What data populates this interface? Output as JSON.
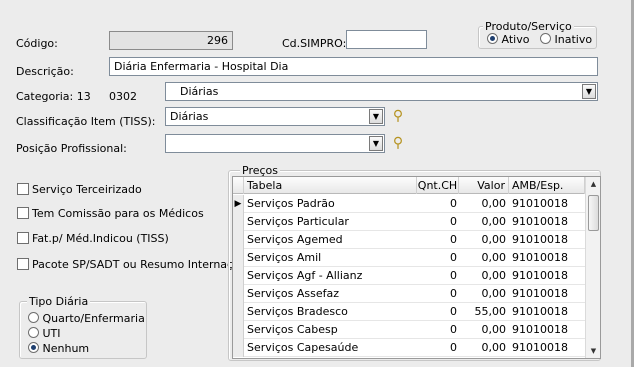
{
  "form": {
    "codigo_label": "Código:",
    "codigo_value": "296",
    "cdsimpro_label": "Cd.SIMPRO:",
    "cdsimpro_value": "",
    "descricao_label": "Descrição:",
    "descricao_value": "Diária Enfermaria - Hospital Dia",
    "categoria_label": "Categoria: 13",
    "categoria_code": "0302",
    "categoria_value": "Diárias",
    "classificacao_label": "Classificação Item (TISS):",
    "classificacao_value": "Diárias",
    "posicao_label": "Posição Profissional:",
    "posicao_value": ""
  },
  "produto_servico": {
    "legend": "Produto/Serviço",
    "ativo": "Ativo",
    "inativo": "Inativo",
    "selected": "Ativo"
  },
  "checkboxes": {
    "servico_terceirizado": "Serviço Terceirizado",
    "tem_comissao": "Tem Comissão para os Médicos",
    "fat_med_indicou": "Fat.p/ Méd.Indicou (TISS)",
    "pacote": "Pacote SP/SADT ou Resumo Internação"
  },
  "tipo_diaria": {
    "legend": "Tipo Diária",
    "options": [
      "Quarto/Enfermaria",
      "UTI",
      "Nenhum"
    ],
    "selected": "Nenhum"
  },
  "precos": {
    "legend": "Preços",
    "columns": [
      "Tabela",
      "Qnt.CH",
      "Valor",
      "AMB/Esp."
    ],
    "rows": [
      [
        "Serviços Padrão",
        "0",
        "0,00",
        "91010018"
      ],
      [
        "Serviços Particular",
        "0",
        "0,00",
        "91010018"
      ],
      [
        "Serviços Agemed",
        "0",
        "0,00",
        "91010018"
      ],
      [
        "Serviços Amil",
        "0",
        "0,00",
        "91010018"
      ],
      [
        "Serviços Agf - Allianz",
        "0",
        "0,00",
        "91010018"
      ],
      [
        "Serviços Assefaz",
        "0",
        "0,00",
        "91010018"
      ],
      [
        "Serviços Bradesco",
        "0",
        "55,00",
        "91010018"
      ],
      [
        "Serviços Cabesp",
        "0",
        "0,00",
        "91010018"
      ],
      [
        "Serviços Capesaúde",
        "0",
        "0,00",
        "91010018"
      ]
    ],
    "current_row_marker": "▶"
  },
  "icons": {
    "lookup": "binoculars-icon",
    "dropdown": "chevron-down-icon"
  }
}
